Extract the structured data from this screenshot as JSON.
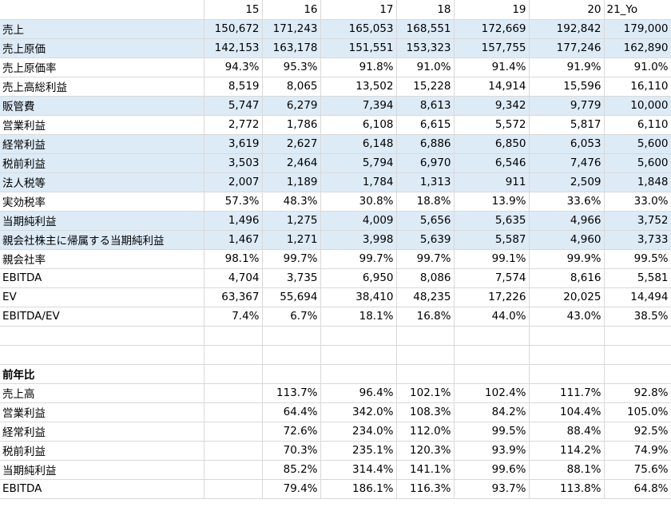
{
  "header": [
    "15",
    "16",
    "17",
    "18",
    "19",
    "20",
    "21_Yo"
  ],
  "rows": [
    {
      "label": "売上",
      "values": [
        "150,672",
        "171,243",
        "165,053",
        "168,551",
        "172,669",
        "192,842",
        "179,000"
      ],
      "hl": true
    },
    {
      "label": "売上原価",
      "values": [
        "142,153",
        "163,178",
        "151,551",
        "153,323",
        "157,755",
        "177,246",
        "162,890"
      ],
      "hl": true
    },
    {
      "label": "売上原価率",
      "values": [
        "94.3%",
        "95.3%",
        "91.8%",
        "91.0%",
        "91.4%",
        "91.9%",
        "91.0%"
      ],
      "indent": true
    },
    {
      "label": "売上高総利益",
      "values": [
        "8,519",
        "8,065",
        "13,502",
        "15,228",
        "14,914",
        "15,596",
        "16,110"
      ]
    },
    {
      "label": "販管費",
      "values": [
        "5,747",
        "6,279",
        "7,394",
        "8,613",
        "9,342",
        "9,779",
        "10,000"
      ],
      "hl": true
    },
    {
      "label": "営業利益",
      "values": [
        "2,772",
        "1,786",
        "6,108",
        "6,615",
        "5,572",
        "5,817",
        "6,110"
      ]
    },
    {
      "label": "経常利益",
      "values": [
        "3,619",
        "2,627",
        "6,148",
        "6,886",
        "6,850",
        "6,053",
        "5,600"
      ],
      "hl": true
    },
    {
      "label": "税前利益",
      "values": [
        "3,503",
        "2,464",
        "5,794",
        "6,970",
        "6,546",
        "7,476",
        "5,600"
      ],
      "hl": true
    },
    {
      "label": "法人税等",
      "values": [
        "2,007",
        "1,189",
        "1,784",
        "1,313",
        "911",
        "2,509",
        "1,848"
      ],
      "hl": true
    },
    {
      "label": "実効税率",
      "values": [
        "57.3%",
        "48.3%",
        "30.8%",
        "18.8%",
        "13.9%",
        "33.6%",
        "33.0%"
      ],
      "indent": true
    },
    {
      "label": "当期純利益",
      "values": [
        "1,496",
        "1,275",
        "4,009",
        "5,656",
        "5,635",
        "4,966",
        "3,752"
      ],
      "hl": true
    },
    {
      "label": "親会社株主に帰属する当期純利益",
      "values": [
        "1,467",
        "1,271",
        "3,998",
        "5,639",
        "5,587",
        "4,960",
        "3,733"
      ],
      "hl": true
    },
    {
      "label": "親会社率",
      "values": [
        "98.1%",
        "99.7%",
        "99.7%",
        "99.7%",
        "99.1%",
        "99.9%",
        "99.5%"
      ],
      "indent": true
    },
    {
      "label": "EBITDA",
      "values": [
        "4,704",
        "3,735",
        "6,950",
        "8,086",
        "7,574",
        "8,616",
        "5,581"
      ]
    },
    {
      "label": "EV",
      "values": [
        "63,367",
        "55,694",
        "38,410",
        "48,235",
        "17,226",
        "20,025",
        "14,494"
      ]
    },
    {
      "label": "EBITDA/EV",
      "values": [
        "7.4%",
        "6.7%",
        "18.1%",
        "16.8%",
        "44.0%",
        "43.0%",
        "38.5%"
      ]
    },
    {
      "label": "",
      "values": [
        "",
        "",
        "",
        "",
        "",
        "",
        ""
      ]
    },
    {
      "label": "",
      "values": [
        "",
        "",
        "",
        "",
        "",
        "",
        ""
      ]
    },
    {
      "label": "前年比",
      "values": [
        "",
        "",
        "",
        "",
        "",
        "",
        ""
      ],
      "bold": true
    },
    {
      "label": "売上高",
      "values": [
        "",
        "113.7%",
        "96.4%",
        "102.1%",
        "102.4%",
        "111.7%",
        "92.8%"
      ]
    },
    {
      "label": "営業利益",
      "values": [
        "",
        "64.4%",
        "342.0%",
        "108.3%",
        "84.2%",
        "104.4%",
        "105.0%"
      ]
    },
    {
      "label": "経常利益",
      "values": [
        "",
        "72.6%",
        "234.0%",
        "112.0%",
        "99.5%",
        "88.4%",
        "92.5%"
      ]
    },
    {
      "label": "税前利益",
      "values": [
        "",
        "70.3%",
        "235.1%",
        "120.3%",
        "93.9%",
        "114.2%",
        "74.9%"
      ]
    },
    {
      "label": "当期純利益",
      "values": [
        "",
        "85.2%",
        "314.4%",
        "141.1%",
        "99.6%",
        "88.1%",
        "75.6%"
      ]
    },
    {
      "label": "EBITDA",
      "values": [
        "",
        "79.4%",
        "186.1%",
        "116.3%",
        "93.7%",
        "113.8%",
        "64.8%"
      ]
    }
  ]
}
